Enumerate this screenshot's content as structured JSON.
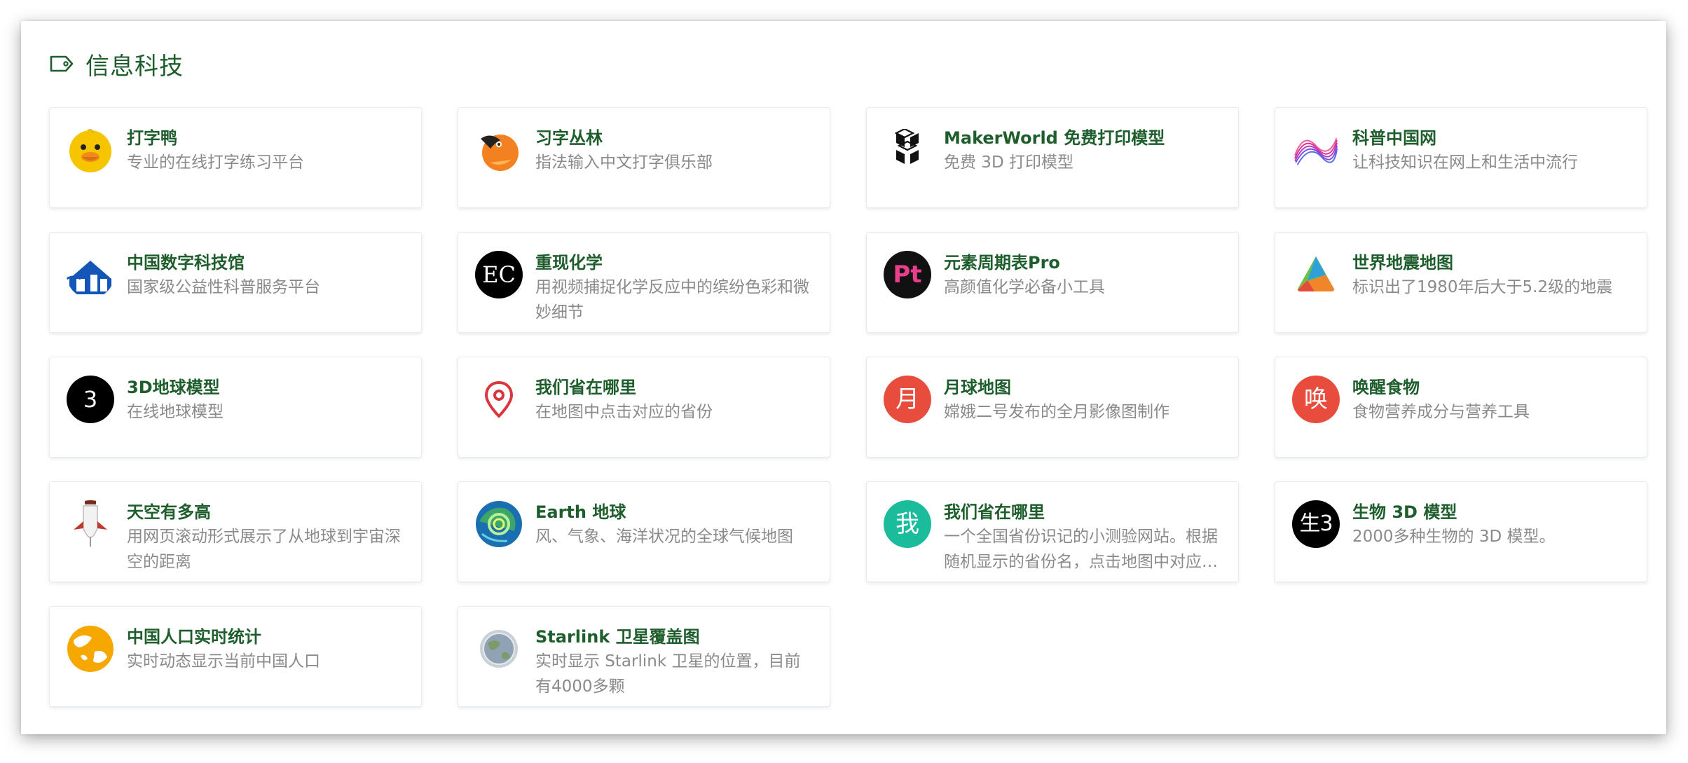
{
  "section": {
    "title": "信息科技",
    "icon": "tag-icon"
  },
  "cards": [
    {
      "name": "打字鸭",
      "desc": "专业的在线打字练习平台",
      "icon": "duck-icon"
    },
    {
      "name": "习字丛林",
      "desc": "指法输入中文打字俱乐部",
      "icon": "bird-icon"
    },
    {
      "name": "MakerWorld 免费打印模型",
      "desc": "免费 3D 打印模型",
      "icon": "cube-logo-icon"
    },
    {
      "name": "科普中国网",
      "desc": "让科技知识在网上和生活中流行",
      "icon": "wave-logo-icon"
    },
    {
      "name": "中国数字科技馆",
      "desc": "国家级公益性科普服务平台",
      "icon": "cdstm-logo-icon"
    },
    {
      "name": "重现化学",
      "desc": "用视频捕捉化学反应中的缤纷色彩和微妙细节",
      "icon": "ec-logo-icon",
      "glyph": "EC"
    },
    {
      "name": "元素周期表Pro",
      "desc": "高颜值化学必备小工具",
      "icon": "pt-logo-icon",
      "glyph": "Pt"
    },
    {
      "name": "世界地震地图",
      "desc": "标识出了1980年后大于5.2级的地震",
      "icon": "mountain-logo-icon"
    },
    {
      "name": "3D地球模型",
      "desc": "在线地球模型",
      "icon": "letter-avatar-icon",
      "glyph": "3"
    },
    {
      "name": "我们省在哪里",
      "desc": "在地图中点击对应的省份",
      "icon": "map-pin-icon"
    },
    {
      "name": "月球地图",
      "desc": "嫦娥二号发布的全月影像图制作",
      "icon": "letter-avatar-icon",
      "glyph": "月"
    },
    {
      "name": "唤醒食物",
      "desc": "食物营养成分与营养工具",
      "icon": "letter-avatar-icon",
      "glyph": "唤"
    },
    {
      "name": "天空有多高",
      "desc": "用网页滚动形式展示了从地球到宇宙深空的距离",
      "icon": "rocket-icon"
    },
    {
      "name": "Earth 地球",
      "desc": "风、气象、海洋状况的全球气候地图",
      "icon": "globe-swirl-icon"
    },
    {
      "name": "我们省在哪里",
      "desc": "一个全国省份识记的小测验网站。根据随机显示的省份名，点击地图中对应的省份。",
      "icon": "letter-avatar-icon",
      "glyph": "我"
    },
    {
      "name": "生物 3D 模型",
      "desc": "2000多种生物的 3D 模型。",
      "icon": "letter-avatar-icon",
      "glyph": "生3"
    },
    {
      "name": "中国人口实时统计",
      "desc": "实时动态显示当前中国人口",
      "icon": "globe-yellow-icon"
    },
    {
      "name": "Starlink 卫星覆盖图",
      "desc": "实时显示 Starlink 卫星的位置，目前有4000多颗",
      "icon": "globe-grey-icon"
    }
  ],
  "colors": {
    "title_green": "#1e5d2c",
    "desc_grey": "#8a8a8a",
    "avatar_black": "#000000",
    "avatar_red": "#e74c3c",
    "avatar_teal": "#1abc9c",
    "avatar_magenta": "#e83e8c"
  }
}
